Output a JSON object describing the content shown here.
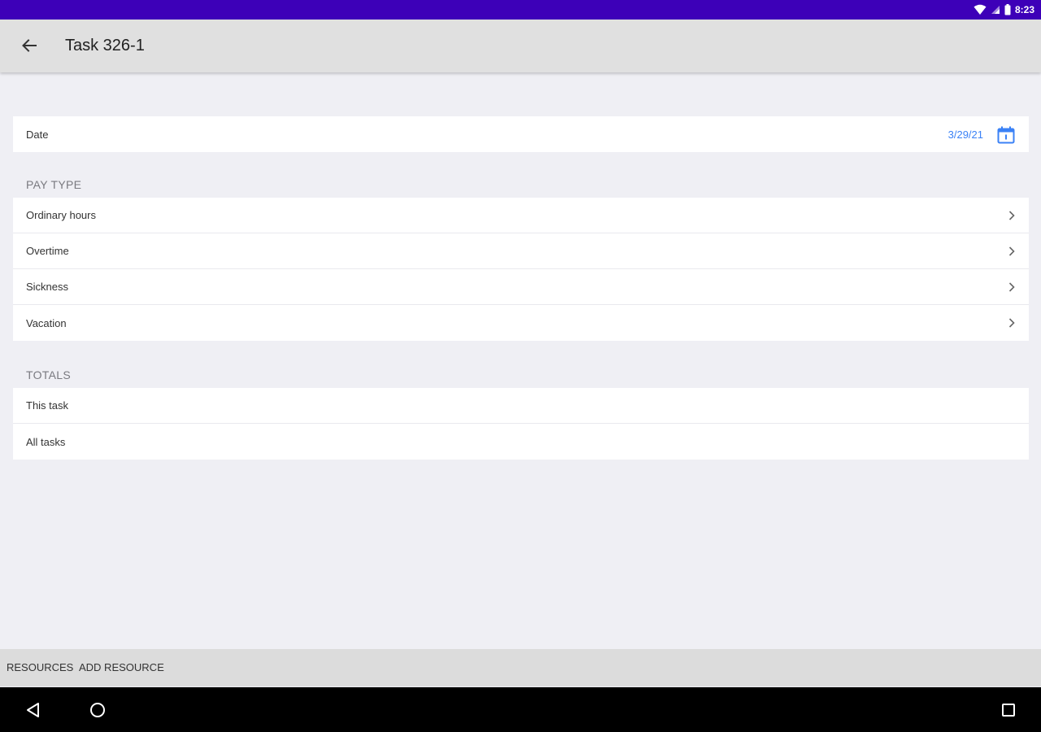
{
  "status_bar": {
    "time": "8:23",
    "color": "#3d00b8"
  },
  "app_bar": {
    "title": "Task 326-1",
    "back_icon": "arrow-left-icon"
  },
  "date_row": {
    "label": "Date",
    "value": "3/29/21",
    "icon": "calendar-icon",
    "accent": "#3b82f6"
  },
  "pay_type": {
    "header": "PAY TYPE",
    "items": [
      {
        "label": "Ordinary hours"
      },
      {
        "label": "Overtime"
      },
      {
        "label": "Sickness"
      },
      {
        "label": "Vacation"
      }
    ]
  },
  "totals": {
    "header": "TOTALS",
    "items": [
      {
        "label": "This task"
      },
      {
        "label": "All tasks"
      }
    ]
  },
  "bottom_bar": {
    "resources_label": "RESOURCES",
    "add_resource_label": "ADD RESOURCE"
  },
  "nav_bar": {
    "icons": [
      "back-triangle-icon",
      "home-circle-icon",
      "recents-square-icon"
    ]
  }
}
